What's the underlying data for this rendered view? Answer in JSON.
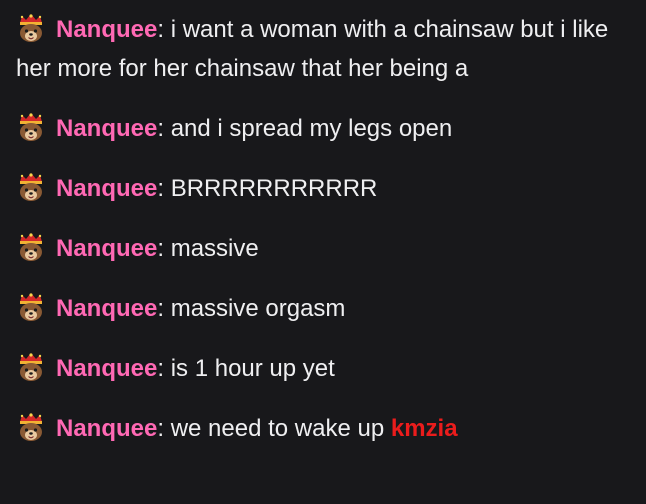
{
  "colors": {
    "background": "#18181b",
    "text": "#efeff1",
    "username": "#ff69b4",
    "mention": "#eb1c1c"
  },
  "messages": [
    {
      "badge": "crowned-animal-badge-icon",
      "user": "Nanquee",
      "sep": ": ",
      "text": "i want a woman with a chainsaw but i like her more for her chainsaw that her being a",
      "mention": ""
    },
    {
      "badge": "crowned-animal-badge-icon",
      "user": "Nanquee",
      "sep": ": ",
      "text": "and i spread my legs open",
      "mention": ""
    },
    {
      "badge": "crowned-animal-badge-icon",
      "user": "Nanquee",
      "sep": ": ",
      "text": "BRRRRRRRRRRR",
      "mention": ""
    },
    {
      "badge": "crowned-animal-badge-icon",
      "user": "Nanquee",
      "sep": ": ",
      "text": "massive",
      "mention": ""
    },
    {
      "badge": "crowned-animal-badge-icon",
      "user": "Nanquee",
      "sep": ": ",
      "text": "massive orgasm",
      "mention": ""
    },
    {
      "badge": "crowned-animal-badge-icon",
      "user": "Nanquee",
      "sep": ": ",
      "text": "is 1 hour up yet",
      "mention": ""
    },
    {
      "badge": "crowned-animal-badge-icon",
      "user": "Nanquee",
      "sep": ": ",
      "text": "we need to wake up ",
      "mention": "kmzia"
    }
  ]
}
